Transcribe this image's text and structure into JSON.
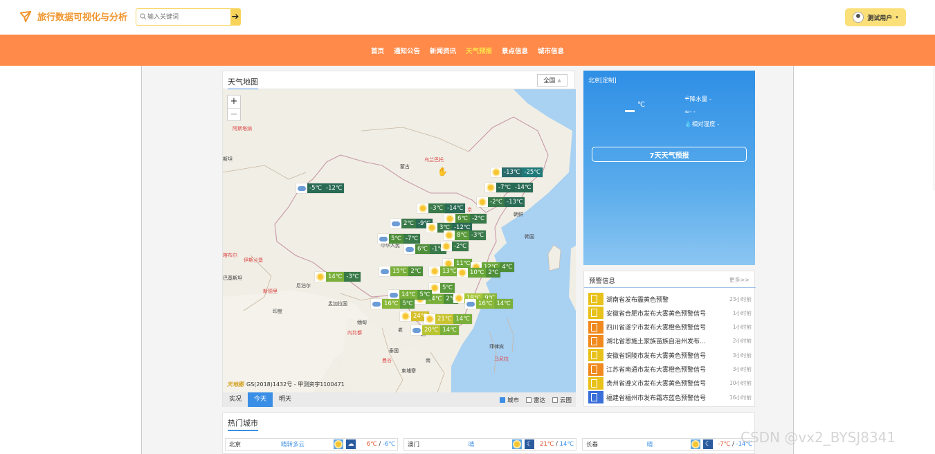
{
  "header": {
    "site_title": "旅行数据可视化与分析",
    "search_placeholder": "输入关键词",
    "search_button": "➔",
    "user_label": "测试用户"
  },
  "nav": {
    "items": [
      "首页",
      "通知公告",
      "新闻资讯",
      "天气预报",
      "景点信息",
      "城市信息"
    ],
    "active": "天气预报"
  },
  "map": {
    "title": "天气地图",
    "scope": "全国",
    "zoom_in": "+",
    "zoom_out": "−",
    "credit_logo": "天地图",
    "credit": "GS(2018)1432号 - 甲测资字1100471",
    "tabs": [
      "实况",
      "今天",
      "明天"
    ],
    "active_tab": "今天",
    "layers": [
      {
        "label": "城市",
        "checked": true
      },
      {
        "label": "雷达",
        "checked": false
      },
      {
        "label": "云图",
        "checked": false
      }
    ],
    "labels": [
      {
        "text": "阿斯塔纳",
        "red": true
      },
      {
        "text": "斯坦",
        "red": false
      },
      {
        "text": "蒙古",
        "red": false
      },
      {
        "text": "乌兰巴托",
        "red": true
      },
      {
        "text": "朝鲜",
        "red": false
      },
      {
        "text": "韩国",
        "red": false
      },
      {
        "text": "中华人民",
        "red": false
      },
      {
        "text": "伊斯兰堡",
        "red": true
      },
      {
        "text": "喀布尔",
        "red": true
      },
      {
        "text": "巴基斯坦",
        "red": false
      },
      {
        "text": "尼泊尔",
        "red": false
      },
      {
        "text": "新德里",
        "red": true
      },
      {
        "text": "印度",
        "red": false
      },
      {
        "text": "孟加拉国",
        "red": false
      },
      {
        "text": "缅甸",
        "red": false
      },
      {
        "text": "内比都",
        "red": true
      },
      {
        "text": "老",
        "red": false
      },
      {
        "text": "泰国",
        "red": false
      },
      {
        "text": "曼谷",
        "red": true
      },
      {
        "text": "越",
        "red": false
      },
      {
        "text": "柬埔寨",
        "red": false
      },
      {
        "text": "南",
        "red": false
      },
      {
        "text": "菲律宾",
        "red": false
      },
      {
        "text": "马尼拉",
        "red": true
      },
      {
        "text": "京",
        "red": true
      }
    ],
    "markers": [
      {
        "icon": "sun",
        "hi": "-13℃",
        "lo": "-25℃",
        "hc": "#2a6b6b",
        "lc": "#1f7a7a"
      },
      {
        "icon": "sun",
        "hi": "-7℃",
        "lo": "-14℃",
        "hc": "#2a6b55",
        "lc": "#2a6b55"
      },
      {
        "icon": "sun",
        "hi": "-2℃",
        "lo": "-13℃",
        "hc": "#3a7a4a",
        "lc": "#2a6b55"
      },
      {
        "icon": "cloud",
        "hi": "-5℃",
        "lo": "-12℃",
        "hc": "#2a6b55",
        "lc": "#2a6b55"
      },
      {
        "icon": "sun",
        "hi": "-3℃",
        "lo": "-14℃",
        "hc": "#3a7a4a",
        "lc": "#2a6b55"
      },
      {
        "icon": "sun",
        "hi": "6℃",
        "lo": "-2℃",
        "hc": "#4f8f3a",
        "lc": "#3a7a4a"
      },
      {
        "icon": "cloud",
        "hi": "2℃",
        "lo": "-9℃",
        "hc": "#3a7a4a",
        "lc": "#2a6b55"
      },
      {
        "icon": "sun",
        "hi": "3℃",
        "lo": "-12℃",
        "hc": "#3a7a4a",
        "lc": "#2a6b55"
      },
      {
        "icon": "sun",
        "hi": "8℃",
        "lo": "-3℃",
        "hc": "#5a9a3a",
        "lc": "#3a7a4a"
      },
      {
        "icon": "cloud",
        "hi": "5℃",
        "lo": "-7℃",
        "hc": "#4f8f3a",
        "lc": "#3a7a4a"
      },
      {
        "icon": "cloud",
        "hi": "6℃",
        "lo": "-1℃",
        "hc": "#4f8f3a",
        "lc": "#3a7a4a"
      },
      {
        "icon": "sun",
        "hi": "",
        "lo": "-2℃",
        "hc": "#4f8f3a",
        "lc": "#3a7a4a"
      },
      {
        "icon": "sun",
        "hi": "11℃",
        "lo": "",
        "hc": "#6aa83a",
        "lc": "#3a7a4a"
      },
      {
        "icon": "sun",
        "hi": "12℃",
        "lo": "4℃",
        "hc": "#6aa83a",
        "lc": "#4f8f3a"
      },
      {
        "icon": "cloud",
        "hi": "15℃",
        "lo": "2℃",
        "hc": "#7ab03a",
        "lc": "#4f8f3a"
      },
      {
        "icon": "sun",
        "hi": "13℃",
        "lo": "",
        "hc": "#7ab03a",
        "lc": "#4f8f3a"
      },
      {
        "icon": "sun",
        "hi": "10℃",
        "lo": "2℃",
        "hc": "#6aa83a",
        "lc": "#4f8f3a"
      },
      {
        "icon": "sun",
        "hi": "14℃",
        "lo": "-3℃",
        "hc": "#7ab03a",
        "lc": "#3a7a4a"
      },
      {
        "icon": "sun",
        "hi": "",
        "lo": "5℃",
        "hc": "#7ab03a",
        "lc": "#5a9a3a"
      },
      {
        "icon": "sun",
        "hi": "14℃",
        "lo": "2℃",
        "hc": "#7ab03a",
        "lc": "#4f8f3a"
      },
      {
        "icon": "cloud",
        "hi": "14℃",
        "lo": "5℃",
        "hc": "#7ab03a",
        "lc": "#5a9a3a"
      },
      {
        "icon": "sun",
        "hi": "18℃",
        "lo": "9℃",
        "hc": "#a8c83a",
        "lc": "#8ab83a"
      },
      {
        "icon": "cloud",
        "hi": "16℃",
        "lo": "5℃",
        "hc": "#8ab83a",
        "lc": "#5a9a3a"
      },
      {
        "icon": "cloud",
        "hi": "16℃",
        "lo": "14℃",
        "hc": "#8ab83a",
        "lc": "#7ab03a"
      },
      {
        "icon": "sun",
        "hi": "24℃",
        "lo": "",
        "hc": "#d6c02a",
        "lc": "#a8c83a"
      },
      {
        "icon": "sun",
        "hi": "21℃",
        "lo": "14℃",
        "hc": "#c8c430",
        "lc": "#7ab03a"
      },
      {
        "icon": "cloud",
        "hi": "20℃",
        "lo": "14℃",
        "hc": "#b8c430",
        "lc": "#7ab03a"
      }
    ]
  },
  "city_panel": {
    "city": "北京[定制]",
    "temp_unit": "℃",
    "rain": "降水量 -",
    "wind": "- -",
    "humidity": "相对湿度 -",
    "forecast_button": "7天天气预报"
  },
  "warnings": {
    "title": "预警信息",
    "more": "更多>>",
    "items": [
      {
        "text": "湖南省发布霾黄色预警",
        "time": "23小时前",
        "color": "#e8c21a"
      },
      {
        "text": "安徽省合肥市发布大雾黄色预警信号",
        "time": "1小时前",
        "color": "#e8c21a"
      },
      {
        "text": "四川省遂宁市发布大雾橙色预警信号",
        "time": "1小时前",
        "color": "#f08a1e"
      },
      {
        "text": "湖北省恩施土家族苗族自治州发布...",
        "time": "2小时前",
        "color": "#f08a1e"
      },
      {
        "text": "安徽省铜陵市发布大雾黄色预警信号",
        "time": "3小时前",
        "color": "#e8c21a"
      },
      {
        "text": "江苏省南通市发布大雾橙色预警信号",
        "time": "3小时前",
        "color": "#f08a1e"
      },
      {
        "text": "贵州省遵义市发布大雾黄色预警信号",
        "time": "10小时前",
        "color": "#e8c21a"
      },
      {
        "text": "福建省福州市发布霜冻蓝色预警信号",
        "time": "16小时前",
        "color": "#3a6ed8"
      }
    ]
  },
  "hot_cities": {
    "title": "热门城市",
    "items": [
      {
        "name": "北京",
        "weather": "晴转多云",
        "hi": "6℃",
        "lo": "-6℃",
        "night": "☁"
      },
      {
        "name": "澳门",
        "weather": "晴",
        "hi": "21℃",
        "lo": "14℃",
        "night": "☾"
      },
      {
        "name": "长春",
        "weather": "晴",
        "hi": "-7℃",
        "lo": "-14℃",
        "night": "☾"
      }
    ],
    "sep": " / "
  },
  "watermark": "CSDN @vx2_BYSJ8341"
}
